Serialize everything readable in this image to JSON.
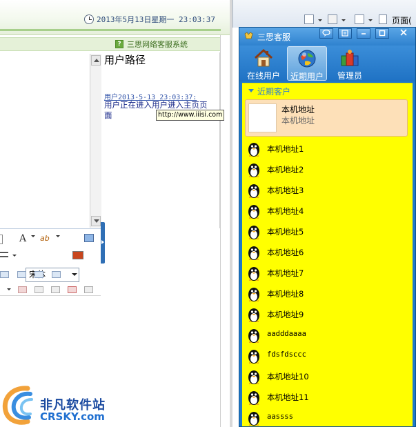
{
  "header": {
    "datetime": "2013年5月13日星期一 23:03:37",
    "system_name": "三思网络客服系统",
    "help_glyph": "?"
  },
  "path_panel": {
    "title": "用户路径",
    "timestamp": "用户2013-5-13 23:03:37:",
    "message": "用户正在进入用户进入主页页面",
    "tooltip": "http://www.iiisi.com"
  },
  "editor": {
    "font_value": "宋体",
    "font_color_glyph": "A",
    "spell_glyph": "ab"
  },
  "browser": {
    "page_menu": "页面(",
    "icons": [
      "home-icon",
      "feed-icon",
      "print-icon",
      "page-icon"
    ]
  },
  "client": {
    "title": "三思客服",
    "window_buttons": [
      "chat-icon",
      "notes-icon",
      "minimize-icon",
      "maximize-icon",
      "close-icon"
    ],
    "tabs": [
      {
        "label": "在线用户",
        "icon": "house-icon"
      },
      {
        "label": "近期用户",
        "icon": "globe-icon"
      },
      {
        "label": "管理员",
        "icon": "group-icon"
      }
    ],
    "section_label": "近期客户",
    "selected": {
      "name": "本机地址",
      "sub": "本机地址"
    },
    "contacts": [
      "本机地址1",
      "本机地址2",
      "本机地址3",
      "本机地址4",
      "本机地址5",
      "本机地址6",
      "本机地址7",
      "本机地址8",
      "本机地址9",
      "aadddaaaa",
      "fdsfdsccc",
      "本机地址10",
      "本机地址11",
      "aassss"
    ]
  },
  "watermark": {
    "name": "非凡软件站",
    "url": "CRSKY.com"
  },
  "colors": {
    "client_blue": "#1f79c9",
    "list_yellow": "#ffff00",
    "selected_bg": "#fde0b8",
    "system_green": "#e5f1d8"
  }
}
